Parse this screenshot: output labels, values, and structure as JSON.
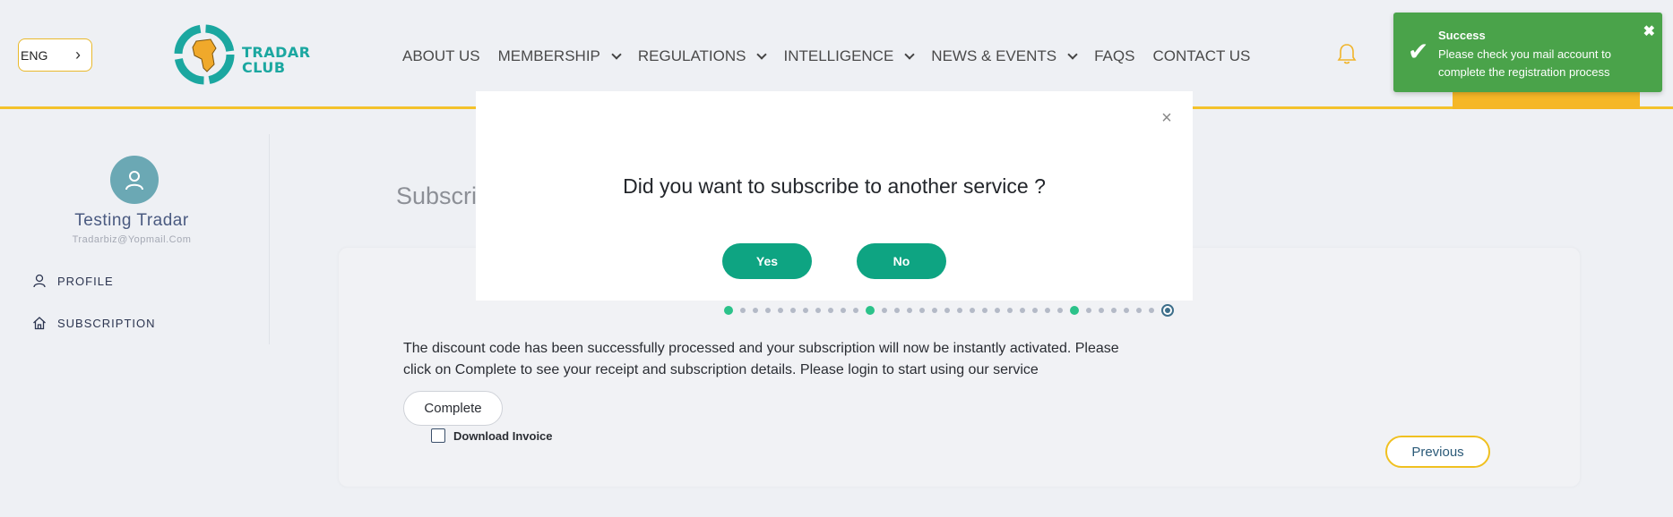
{
  "header": {
    "language": "ENG",
    "logo_text_line1": "TRADAR",
    "logo_text_line2": "CLUB",
    "nav": [
      {
        "label": "ABOUT US",
        "dropdown": false
      },
      {
        "label": "MEMBERSHIP",
        "dropdown": true
      },
      {
        "label": "REGULATIONS",
        "dropdown": true
      },
      {
        "label": "INTELLIGENCE",
        "dropdown": true
      },
      {
        "label": "NEWS & EVENTS",
        "dropdown": true
      },
      {
        "label": "FAQS",
        "dropdown": false
      },
      {
        "label": "CONTACT US",
        "dropdown": false
      }
    ]
  },
  "sidebar": {
    "user_name": "Testing Tradar",
    "user_email": "Tradarbiz@Yopmail.Com",
    "items": [
      {
        "label": "PROFILE",
        "icon": "user-icon"
      },
      {
        "label": "SUBSCRIPTION",
        "icon": "home-icon"
      }
    ]
  },
  "main": {
    "page_title_partial": "Subscrip",
    "message": "The discount code has been successfully processed and your subscription will now be instantly activated. Please click on Complete to see your receipt and subscription details. Please login to start using our service",
    "complete_label": "Complete",
    "download_invoice_label": "Download Invoice",
    "previous_label": "Previous",
    "steps_total": 35,
    "steps_current": 35
  },
  "modal": {
    "question": "Did you want to subscribe to another service ?",
    "yes_label": "Yes",
    "no_label": "No",
    "close_symbol": "×"
  },
  "toast": {
    "title": "Success",
    "body": "Please check you mail account to complete the registration process",
    "close_symbol": "✖",
    "check_symbol": "✔"
  },
  "colors": {
    "accent_green": "#0ea482",
    "toast_green": "#4aa34a",
    "brand_yellow": "#f4c22b",
    "brand_teal": "#1ba7a0"
  }
}
